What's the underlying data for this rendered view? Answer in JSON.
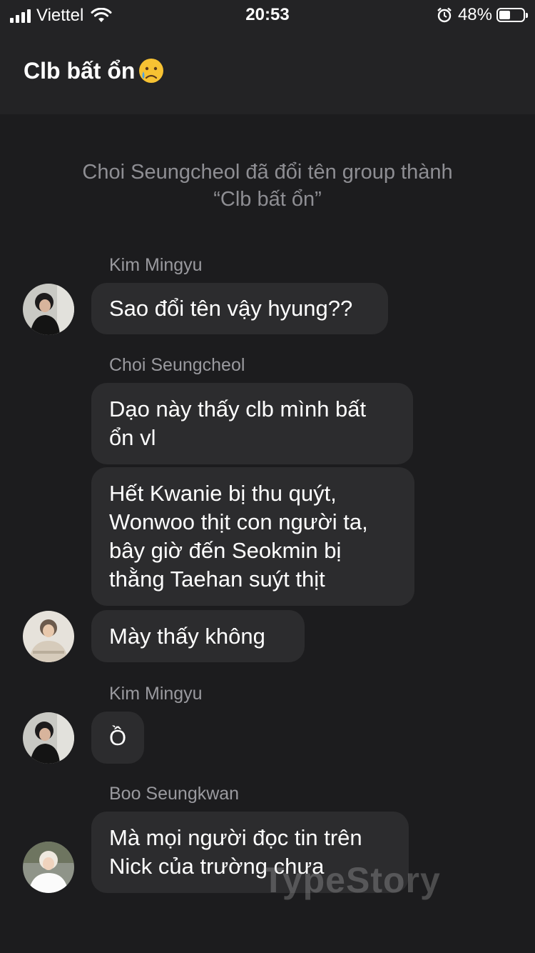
{
  "status_bar": {
    "carrier": "Viettel",
    "time": "20:53",
    "battery_percent": "48%",
    "battery_level": 0.48
  },
  "header": {
    "title": "Clb bất ổn",
    "title_emoji": "crying-face-icon"
  },
  "system_message": "Choi Seungcheol đã đổi tên group thành “Clb bất ổn”",
  "messages": [
    {
      "sender": "Kim Mingyu",
      "text": "Sao đổi tên vậy hyung??"
    },
    {
      "sender": "Choi Seungcheol",
      "text": "Dạo này thấy clb mình bất ổn vl"
    },
    {
      "sender": "",
      "text": "Hết Kwanie bị thu quýt, Wonwoo thịt con người ta, bây giờ đến Seokmin bị thằng Taehan suýt thịt"
    },
    {
      "sender": "",
      "text": "Mày thấy không"
    },
    {
      "sender": "Kim Mingyu",
      "text": "Ồ"
    },
    {
      "sender": "Boo Seungkwan",
      "text": "Mà mọi người đọc tin trên Nick của trường chưa"
    }
  ],
  "watermark": "TypeStory",
  "colors": {
    "background": "#1c1c1e",
    "header": "#232325",
    "bubble": "#2c2c2e",
    "secondary_text": "#8e8e93"
  }
}
